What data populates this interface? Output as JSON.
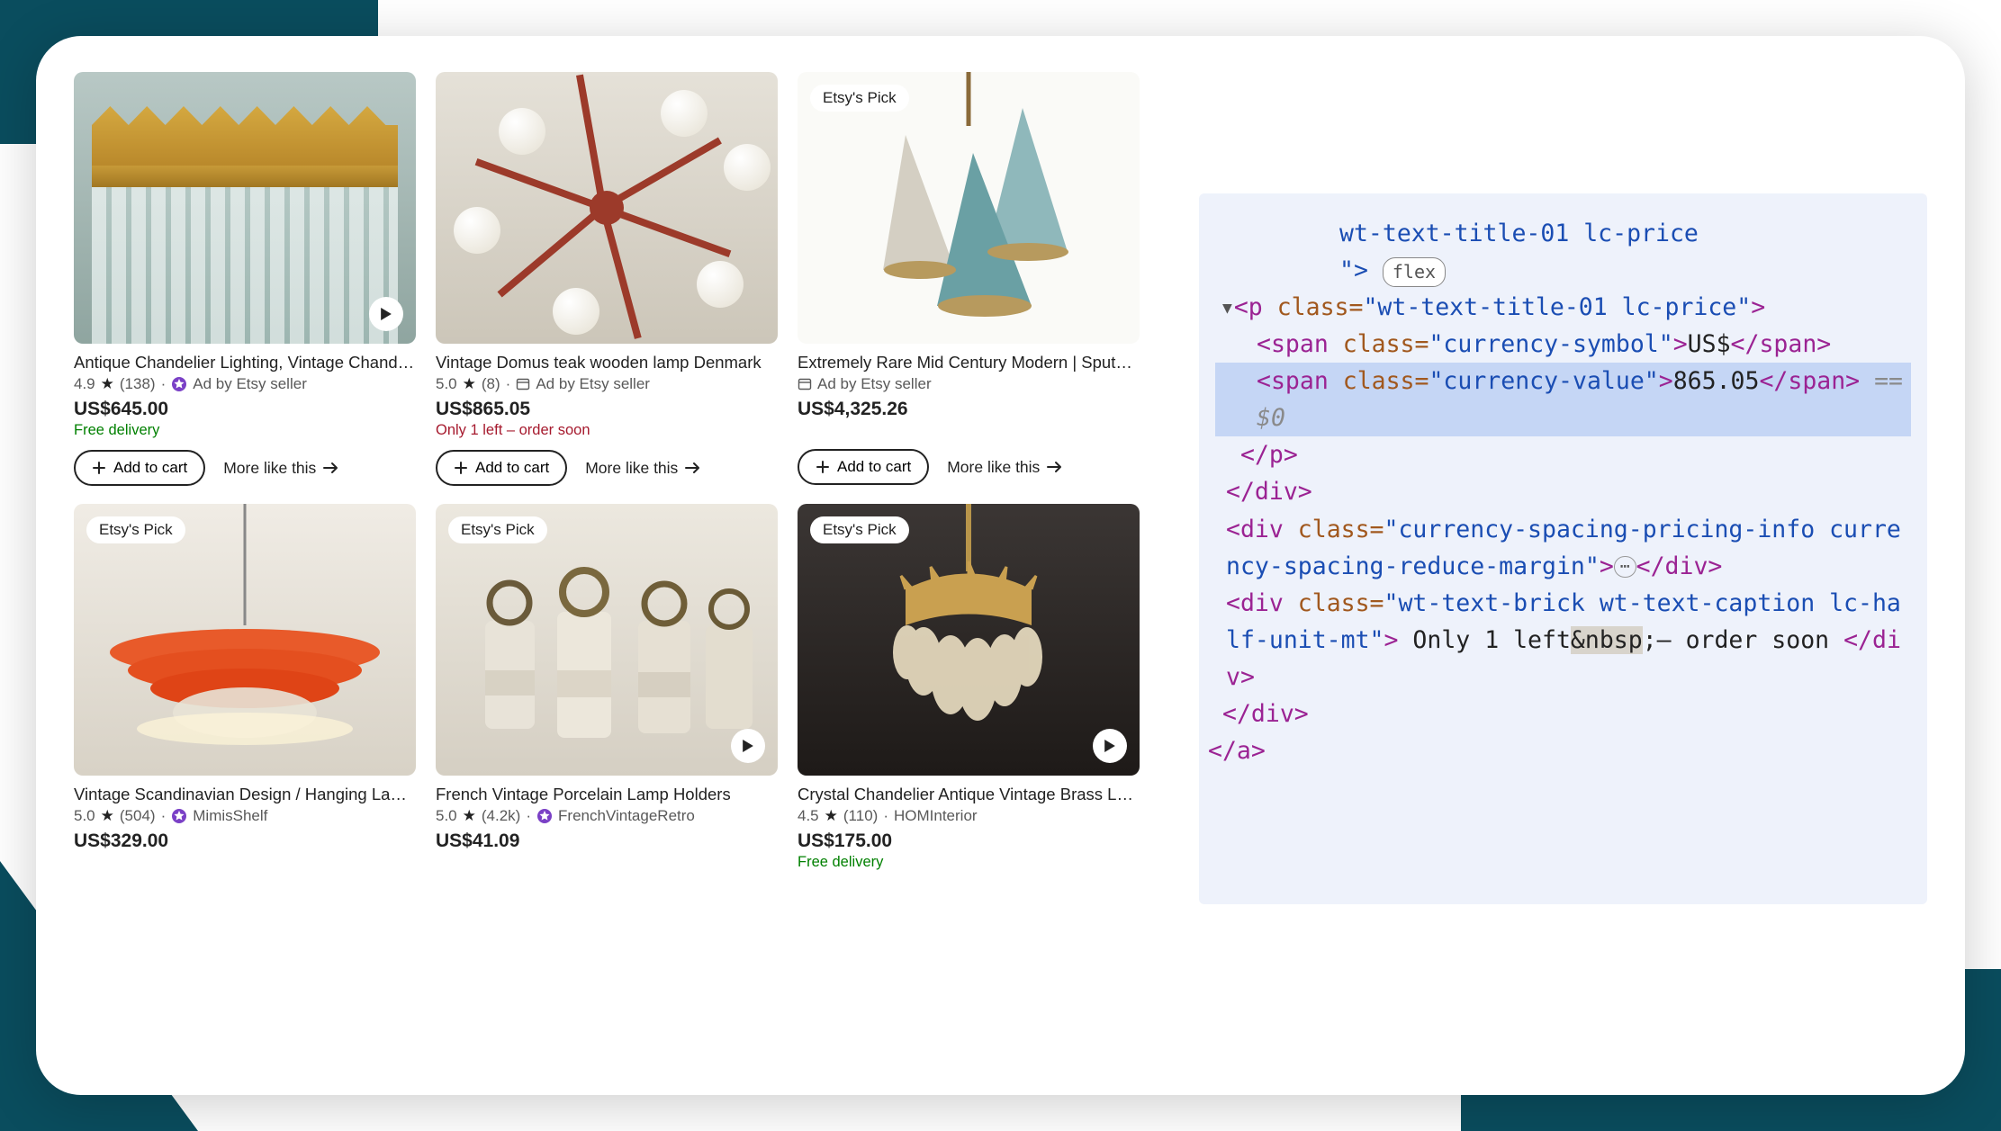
{
  "labels": {
    "etsys_pick": "Etsy's Pick",
    "add_to_cart": "Add to cart",
    "more_like_this": "More like this",
    "ad_by_seller": "Ad by Etsy seller"
  },
  "products": [
    {
      "title": "Antique Chandelier Lighting, Vintage Chandel…",
      "rating": "4.9",
      "reviews": "(138)",
      "ad": true,
      "price_symbol": "US$",
      "price_value": "645.00",
      "sub_text": "Free delivery",
      "sub_class": "green",
      "etsys_pick": false,
      "play": true,
      "show_actions": true
    },
    {
      "title": "Vintage Domus teak wooden lamp Denmark",
      "rating": "5.0",
      "reviews": "(8)",
      "ad": true,
      "ad_icon_variant": "box",
      "price_symbol": "US$",
      "price_value": "865.05",
      "sub_text": "Only 1 left – order soon",
      "sub_class": "red",
      "etsys_pick": false,
      "play": false,
      "show_actions": true
    },
    {
      "title": "Extremely Rare Mid Century Modern | Sputnik …",
      "ad": true,
      "ad_only": true,
      "ad_icon_variant": "box",
      "price_symbol": "US$",
      "price_value": "4,325.26",
      "etsys_pick": true,
      "play": false,
      "show_actions": true
    },
    {
      "title": "Vintage Scandinavian Design / Hanging Lamp …",
      "rating": "5.0",
      "reviews": "(504)",
      "seller": "MimisShelf",
      "star_seller": true,
      "price_symbol": "US$",
      "price_value": "329.00",
      "etsys_pick": true,
      "play": false,
      "show_actions": false
    },
    {
      "title": "French Vintage Porcelain Lamp Holders",
      "rating": "5.0",
      "reviews": "(4.2k)",
      "seller": "FrenchVintageRetro",
      "star_seller": true,
      "price_symbol": "US$",
      "price_value": "41.09",
      "etsys_pick": true,
      "play": true,
      "show_actions": false
    },
    {
      "title": "Crystal Chandelier Antique Vintage Brass LED …",
      "rating": "4.5",
      "reviews": "(110)",
      "seller": "HOMInterior",
      "star_seller": false,
      "price_symbol": "US$",
      "price_value": "175.00",
      "sub_text": "Free delivery",
      "sub_class": "green",
      "etsys_pick": true,
      "play": true,
      "show_actions": false
    }
  ],
  "code": {
    "frag_top": "wt-text-title-01 lc-price",
    "quote_gt": "\">",
    "flex_badge": "flex",
    "p_open_1": "<p ",
    "class_eq": "class=",
    "p_class": "\"wt-text-title-01 lc-price\"",
    "gt": ">",
    "span_open": "<span ",
    "cur_sym_class": "\"currency-symbol\"",
    "cur_sym_text": "US$",
    "span_close": "</span>",
    "cur_val_class": "\"currency-value\"",
    "cur_val_text": "865.05",
    "eq_comment": " == $0",
    "p_close": "</p>",
    "div_close": "</div>",
    "div_open": "<div ",
    "spacing_class": "\"currency-spacing-pricing-info currency-spacing-reduce-margin\"",
    "brick_class": "\"wt-text-brick wt-text-caption lc-half-unit-mt\"",
    "only1_text": " Only 1 left",
    "nbsp_entity": "&nbsp",
    "order_soon": ";– order soon ",
    "a_close": "</a>"
  }
}
